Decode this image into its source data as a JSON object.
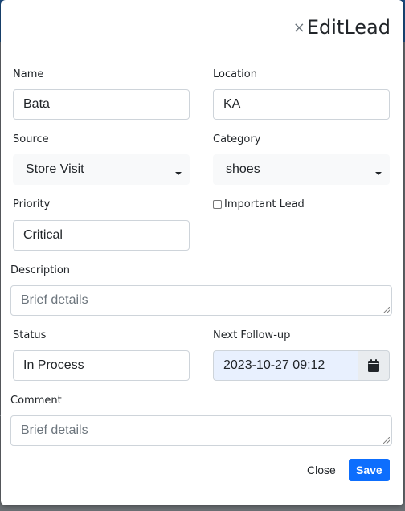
{
  "modal": {
    "title": "EditLead",
    "close_glyph": "×"
  },
  "form": {
    "name": {
      "label": "Name",
      "value": "Bata"
    },
    "location": {
      "label": "Location",
      "value": "KA"
    },
    "source": {
      "label": "Source",
      "value": "Store Visit"
    },
    "category": {
      "label": "Category",
      "value": "shoes"
    },
    "priority": {
      "label": "Priority",
      "value": "Critical"
    },
    "important": {
      "label": "Important Lead",
      "checked": false
    },
    "description": {
      "label": "Description",
      "placeholder": "Brief details"
    },
    "status": {
      "label": "Status",
      "value": "In Process"
    },
    "followup": {
      "label": "Next Follow-up",
      "value": "2023-10-27 09:12",
      "icon": "calendar-icon"
    },
    "comment": {
      "label": "Comment",
      "placeholder": "Brief details"
    }
  },
  "footer": {
    "close_label": "Close",
    "save_label": "Save"
  },
  "colors": {
    "primary": "#0d6efd",
    "backdrop_header": "#1d4f86",
    "autofill_bg": "#e8f0fe"
  }
}
